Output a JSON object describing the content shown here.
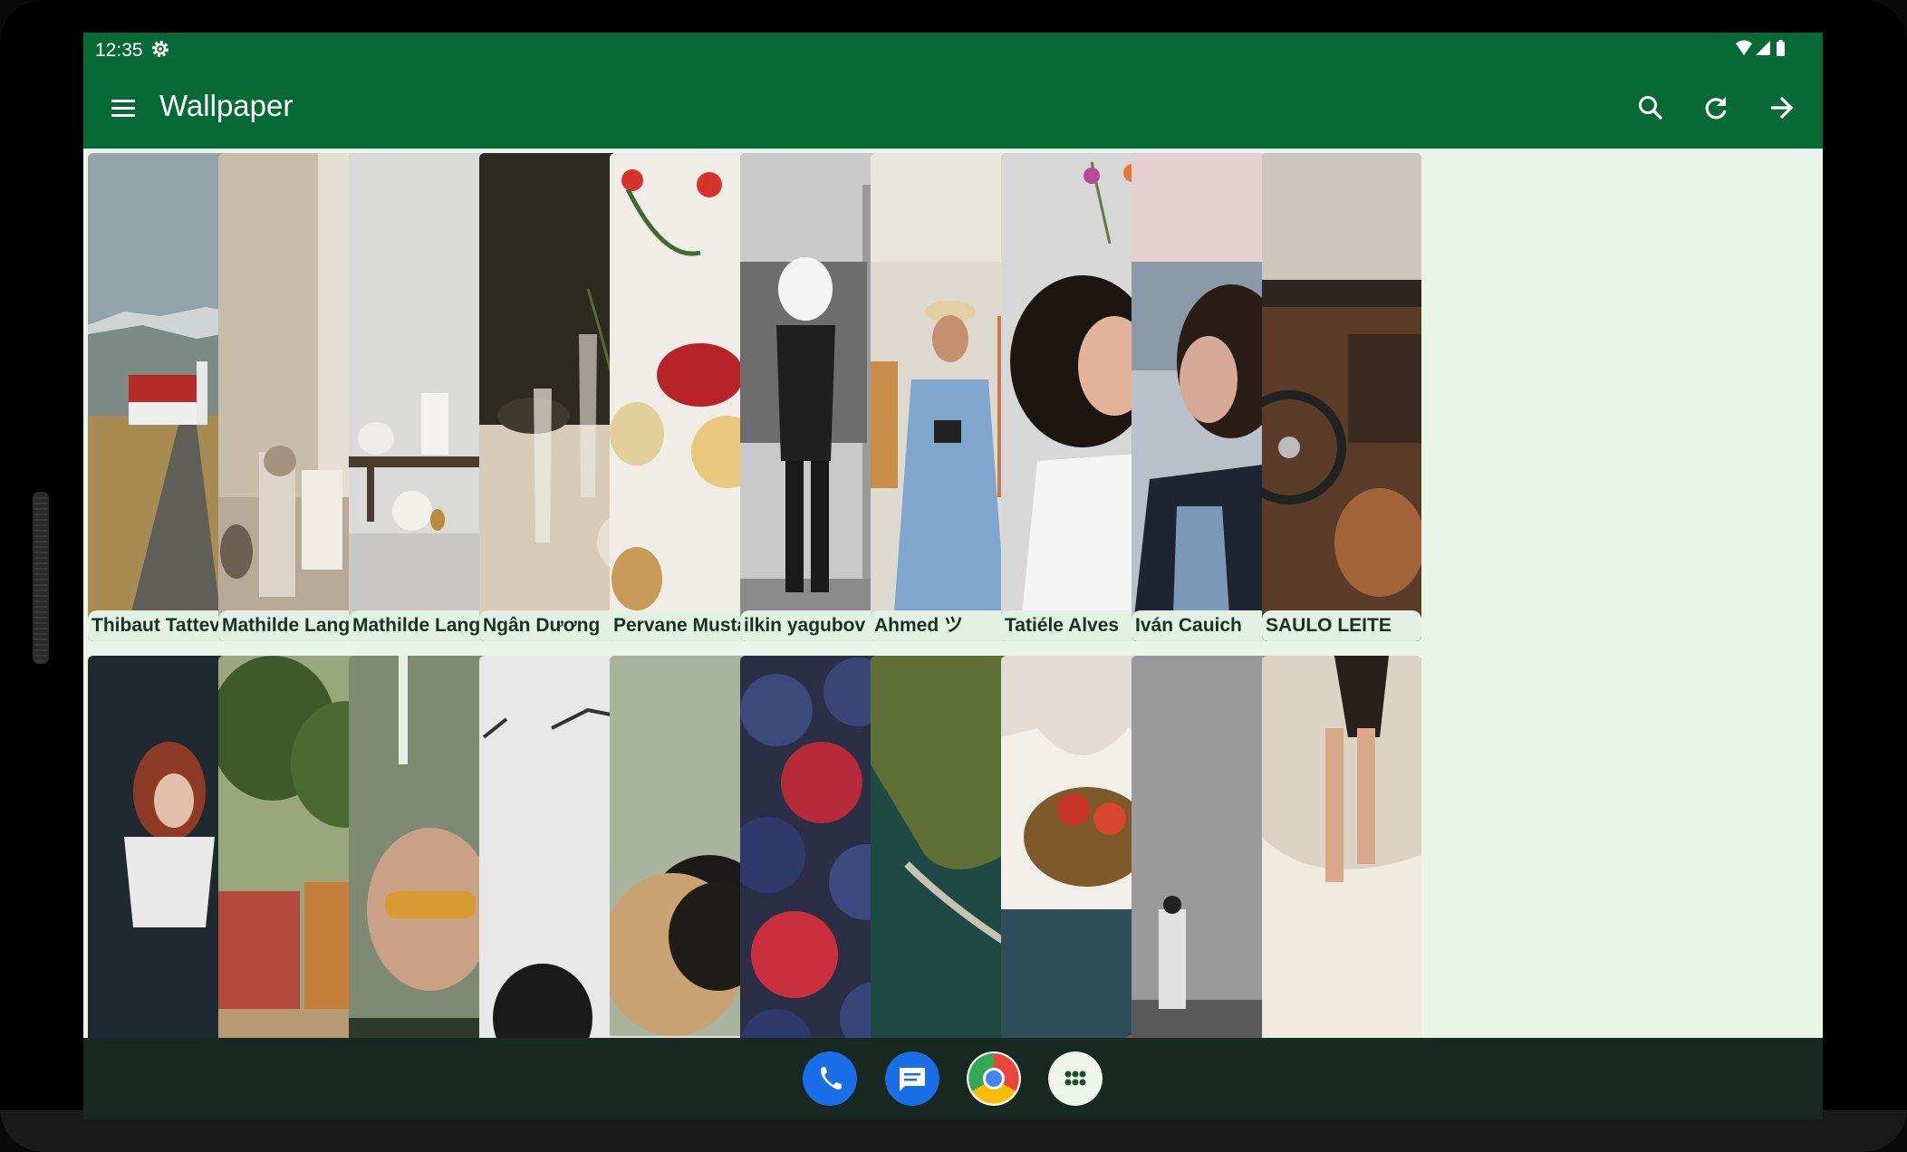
{
  "status_bar": {
    "time": "12:35"
  },
  "app_bar": {
    "title": "Wallpaper"
  },
  "wallpapers_row1": [
    {
      "author": "Thibaut Tattevin"
    },
    {
      "author": "Mathilde Lange..."
    },
    {
      "author": "Mathilde Lange..."
    },
    {
      "author": "Ngân Dương"
    },
    {
      "author": "Pervane Mustaf..."
    },
    {
      "author": "ilkin yagubov"
    },
    {
      "author": "Ahmed ツ"
    },
    {
      "author": "Tatiéle Alves"
    },
    {
      "author": "Iván Cauich"
    },
    {
      "author": "SAULO LEITE"
    }
  ],
  "wallpapers_row2_count_visible": 10,
  "colors": {
    "primary": "#076a36",
    "background": "#eaf5ea",
    "label_bg": "#e3f1e4",
    "nav_bar": "#172920"
  },
  "dock_apps": [
    "phone-icon",
    "messages-icon",
    "chrome-icon",
    "app-drawer-icon"
  ]
}
